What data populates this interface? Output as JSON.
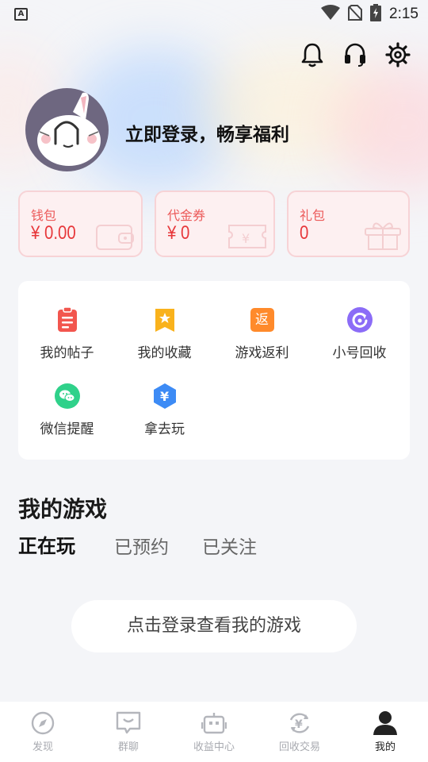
{
  "status_bar": {
    "left_icon_letter": "A",
    "time": "2:15"
  },
  "header": {
    "icons": [
      "bell-icon",
      "headset-icon",
      "gear-icon"
    ],
    "login_prompt": "立即登录，畅享福利"
  },
  "wallet_cards": [
    {
      "title": "钱包",
      "value": "¥ 0.00"
    },
    {
      "title": "代金券",
      "value": "¥ 0"
    },
    {
      "title": "礼包",
      "value": "0"
    }
  ],
  "functions": [
    {
      "label": "我的帖子",
      "icon": "clipboard-icon",
      "color": "#f2564e"
    },
    {
      "label": "我的收藏",
      "icon": "bookmark-star-icon",
      "color": "#f9b21c"
    },
    {
      "label": "游戏返利",
      "icon": "rebate-icon",
      "icon_text": "返",
      "color": "#ff8a2b"
    },
    {
      "label": "小号回收",
      "icon": "recycle-icon",
      "color": "#8b6cf7"
    },
    {
      "label": "微信提醒",
      "icon": "wechat-icon",
      "color": "#2fd18a"
    },
    {
      "label": "拿去玩",
      "icon": "yen-hexagon-icon",
      "icon_text": "¥",
      "color": "#3d8bf5"
    }
  ],
  "my_games": {
    "title": "我的游戏",
    "tabs": [
      "正在玩",
      "已预约",
      "已关注"
    ],
    "active_tab": 0,
    "login_button": "点击登录查看我的游戏"
  },
  "bottom_nav": {
    "items": [
      {
        "label": "发现",
        "icon": "compass-icon"
      },
      {
        "label": "群聊",
        "icon": "chat-icon"
      },
      {
        "label": "收益中心",
        "icon": "robot-icon"
      },
      {
        "label": "回收交易",
        "icon": "recycle-yen-icon"
      },
      {
        "label": "我的",
        "icon": "person-icon"
      }
    ],
    "active_index": 4,
    "inactive_color": "#b4b6bc",
    "active_color": "#222222"
  },
  "colors": {
    "accent_red": "#e7383b",
    "card_bg": "#fdf0f1",
    "avatar_bg": "#6e6780"
  }
}
